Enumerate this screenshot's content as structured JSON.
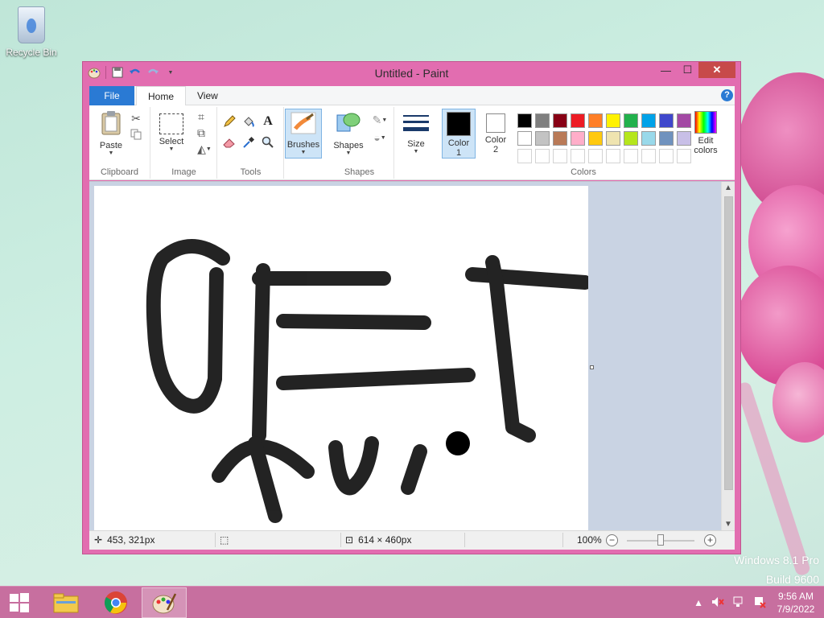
{
  "desktop": {
    "recycle_bin_label": "Recycle Bin",
    "watermark_line1": "Windows 8.1 Pro",
    "watermark_line2": "Build 9600"
  },
  "window": {
    "title": "Untitled - Paint",
    "qat_icons": [
      "paint-app-icon",
      "save-icon",
      "undo-icon",
      "redo-icon",
      "customize-dropdown-icon"
    ],
    "controls": {
      "minimize": "—",
      "maximize": "☐",
      "close": "✕"
    }
  },
  "tabs": {
    "file": "File",
    "home": "Home",
    "view": "View",
    "help": "?"
  },
  "ribbon": {
    "clipboard": {
      "label": "Clipboard",
      "paste": "Paste"
    },
    "image": {
      "label": "Image",
      "select": "Select"
    },
    "tools": {
      "label": "Tools",
      "text_glyph": "A"
    },
    "brushes": {
      "label": "Brushes"
    },
    "shapes": {
      "label": "Shapes",
      "button": "Shapes"
    },
    "size": {
      "label": "Size"
    },
    "colors": {
      "label": "Colors",
      "color1": "Color",
      "color1_num": "1",
      "color2": "Color",
      "color2_num": "2",
      "edit_line1": "Edit",
      "edit_line2": "colors",
      "row1": [
        "#000000",
        "#7f7f7f",
        "#880015",
        "#ed1c24",
        "#ff7f27",
        "#fff200",
        "#22b14c",
        "#00a2e8",
        "#3f48cc",
        "#a349a4"
      ],
      "row2": [
        "#ffffff",
        "#c3c3c3",
        "#b97a57",
        "#ffaec9",
        "#ffc90e",
        "#efe4b0",
        "#b5e61d",
        "#99d9ea",
        "#7092be",
        "#c8bfe7"
      ]
    }
  },
  "status": {
    "cursor_pos": "453, 321px",
    "canvas_size": "614 × 460px",
    "zoom": "100%",
    "zoom_out": "−",
    "zoom_in": "+"
  },
  "taskbar": {
    "time": "9:56 AM",
    "date": "7/9/2022"
  }
}
